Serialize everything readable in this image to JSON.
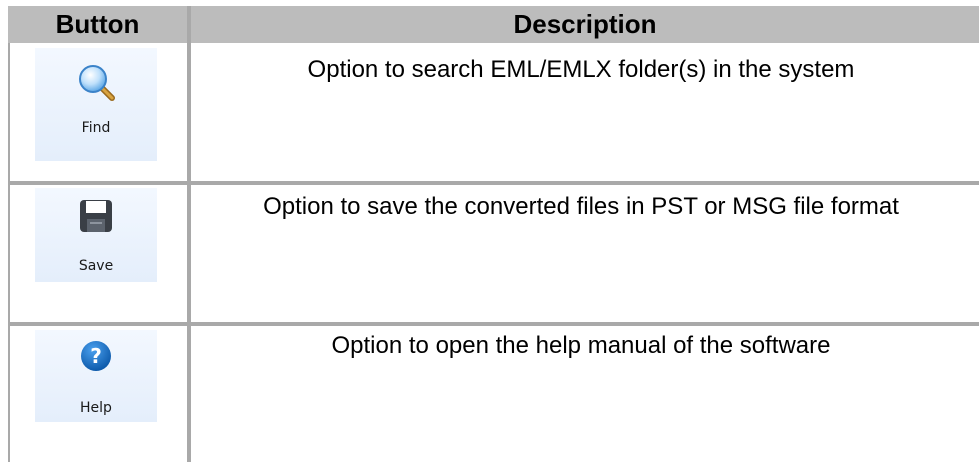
{
  "header": {
    "button_col": "Button",
    "description_col": "Description"
  },
  "rows": [
    {
      "button_label": "Find",
      "icon": "magnifier-icon",
      "description": "Option to search EML/EMLX folder(s) in the system"
    },
    {
      "button_label": "Save",
      "icon": "floppy-disk-icon",
      "description": "Option to save the converted files in PST or MSG file format"
    },
    {
      "button_label": "Help",
      "icon": "question-mark-icon",
      "description": "Option to open the help manual of the software"
    }
  ],
  "colors": {
    "header_bg": "#bcbcbc",
    "grid": "#a9a9a9",
    "button_bg": "#e8f0fc",
    "help_blue": "#1a6fc4"
  }
}
